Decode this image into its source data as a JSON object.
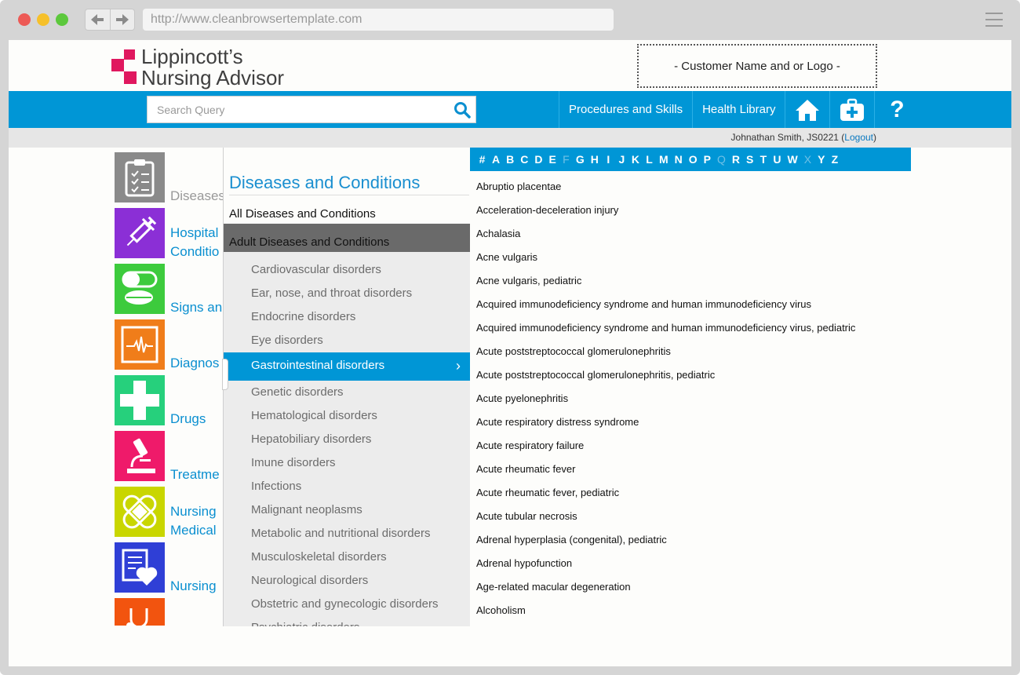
{
  "browser": {
    "url": "http://www.cleanbrowsertemplate.com"
  },
  "header": {
    "logo_line1": "Lippincott’s",
    "logo_line2": "Nursing Advisor",
    "customer_box": "- Customer Name and or Logo -",
    "brand_color": "#e0185f"
  },
  "search": {
    "placeholder": "Search Query"
  },
  "topnav": {
    "procedures": "Procedures and Skills",
    "health_library": "Health Library",
    "help": "?"
  },
  "user": {
    "name": "Johnathan Smith, JS0221",
    "open_paren": "(",
    "logout": "Logout",
    "close_paren": ")"
  },
  "tiles": [
    {
      "label1": "Diseases",
      "label2": "",
      "color": "#8a8a8a",
      "icon": "clipboard-icon"
    },
    {
      "label1": "Hospital",
      "label2": "Conditio",
      "color": "#8b2fd6",
      "icon": "syringe-icon"
    },
    {
      "label1": "Signs an",
      "label2": "",
      "color": "#3dcb3d",
      "icon": "pills-icon"
    },
    {
      "label1": "Diagnos",
      "label2": "",
      "color": "#f07d1a",
      "icon": "monitor-icon"
    },
    {
      "label1": "Drugs",
      "label2": "",
      "color": "#26d07c",
      "icon": "cross-icon"
    },
    {
      "label1": "Treatme",
      "label2": "",
      "color": "#ef1a6a",
      "icon": "microscope-icon"
    },
    {
      "label1": "Nursing",
      "label2": "Medical",
      "color": "#c9d600",
      "icon": "bandage-icon"
    },
    {
      "label1": "Nursing",
      "label2": "",
      "color": "#2f3fd6",
      "icon": "heart-document-icon"
    },
    {
      "label1": "",
      "label2": "",
      "color": "#f2540f",
      "icon": "stethoscope-icon"
    }
  ],
  "middle": {
    "title": "Diseases and Conditions",
    "all": "All Diseases and Conditions",
    "adult": "Adult Diseases and Conditions",
    "items": [
      "Cardiovascular disorders",
      "Ear, nose, and throat disorders",
      "Endocrine disorders",
      "Eye disorders",
      "Gastrointestinal disorders",
      "Genetic disorders",
      "Hematological disorders",
      "Hepatobiliary disorders",
      "Imune disorders",
      "Infections",
      "Malignant neoplasms",
      "Metabolic and nutritional disorders",
      "Musculoskeletal disorders",
      "Neurological disorders",
      "Obstetric and gynecologic disorders",
      "Psychiatric disorders"
    ],
    "active_index": 4,
    "chevron": "›"
  },
  "alphabet": [
    {
      "l": "#",
      "dim": false
    },
    {
      "l": "A",
      "dim": false
    },
    {
      "l": "B",
      "dim": false
    },
    {
      "l": "C",
      "dim": false
    },
    {
      "l": "D",
      "dim": false
    },
    {
      "l": "E",
      "dim": false
    },
    {
      "l": "F",
      "dim": true
    },
    {
      "l": "G",
      "dim": false
    },
    {
      "l": "H",
      "dim": false
    },
    {
      "l": "I",
      "dim": false
    },
    {
      "l": "J",
      "dim": false
    },
    {
      "l": "K",
      "dim": false
    },
    {
      "l": "L",
      "dim": false
    },
    {
      "l": "M",
      "dim": false
    },
    {
      "l": "N",
      "dim": false
    },
    {
      "l": "O",
      "dim": false
    },
    {
      "l": "P",
      "dim": false
    },
    {
      "l": "Q",
      "dim": true
    },
    {
      "l": "R",
      "dim": false
    },
    {
      "l": "S",
      "dim": false
    },
    {
      "l": "T",
      "dim": false
    },
    {
      "l": "U",
      "dim": false
    },
    {
      "l": "W",
      "dim": false
    },
    {
      "l": "X",
      "dim": true
    },
    {
      "l": "Y",
      "dim": false
    },
    {
      "l": "Z",
      "dim": false
    }
  ],
  "conditions": [
    "Abruptio placentae",
    "Acceleration-deceleration injury",
    "Achalasia",
    "Acne vulgaris",
    "Acne vulgaris, pediatric",
    "Acquired immunodeficiency syndrome and human immunodeficiency virus",
    "Acquired immunodeficiency syndrome and human immunodeficiency virus, pediatric",
    "Acute poststreptococcal glomerulonephritis",
    "Acute poststreptococcal glomerulonephritis, pediatric",
    "Acute pyelonephritis",
    "Acute respiratory distress syndrome",
    "Acute respiratory failure",
    "Acute rheumatic fever",
    "Acute rheumatic fever, pediatric",
    "Acute tubular necrosis",
    "Adrenal hyperplasia (congenital), pediatric",
    "Adrenal hypofunction",
    "Age-related macular degeneration",
    "Alcoholism"
  ]
}
